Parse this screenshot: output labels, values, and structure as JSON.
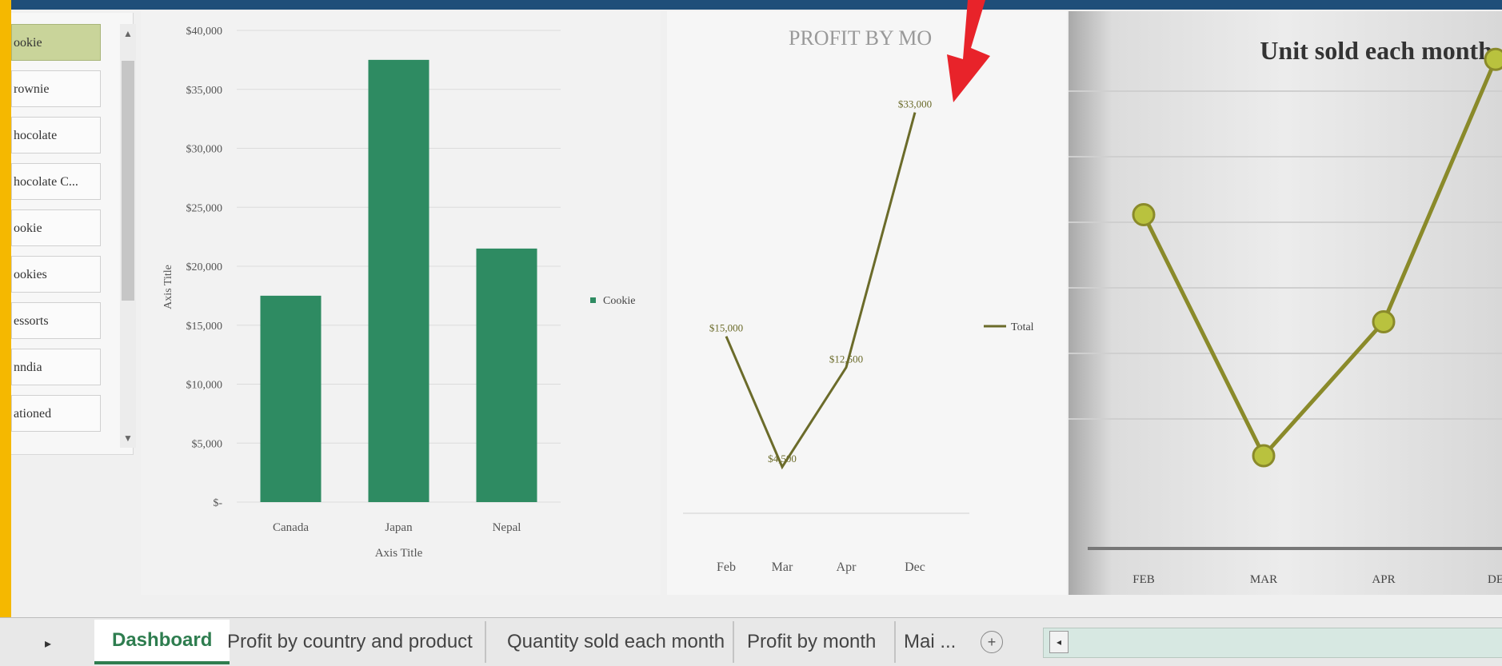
{
  "slicer": {
    "items": [
      {
        "label": "ookie",
        "selected": true
      },
      {
        "label": "rownie",
        "selected": false
      },
      {
        "label": "hocolate",
        "selected": false
      },
      {
        "label": "hocolate C...",
        "selected": false
      },
      {
        "label": "ookie",
        "selected": false
      },
      {
        "label": "ookies",
        "selected": false
      },
      {
        "label": "essorts",
        "selected": false
      },
      {
        "label": "nndia",
        "selected": false
      },
      {
        "label": "ationed",
        "selected": false
      }
    ],
    "scroll_up": "▲",
    "scroll_down": "▼"
  },
  "chart_data": [
    {
      "type": "bar",
      "categories": [
        "Canada",
        "Japan",
        "Nepal"
      ],
      "values": [
        17500,
        37500,
        21500
      ],
      "yticks": [
        "$40,000",
        "$35,000",
        "$30,000",
        "$25,000",
        "$20,000",
        "$15,000",
        "$10,000",
        "$5,000",
        "$-"
      ],
      "ylim": [
        0,
        40000
      ],
      "ylabel": "Axis Title",
      "xlabel": "Axis Title",
      "legend": "Cookie",
      "legend_position": "right",
      "color": "#2e8b62",
      "grid": true
    },
    {
      "type": "line",
      "title": "PROFIT BY MO",
      "x": [
        "Feb",
        "Mar",
        "Apr",
        "Dec"
      ],
      "values": [
        15000,
        4500,
        12500,
        33000
      ],
      "data_labels": [
        "$15,000",
        "$4,500",
        "$12,500",
        "$33,000"
      ],
      "legend": "Total",
      "legend_position": "right",
      "color": "#6b6b2a"
    },
    {
      "type": "line",
      "title": "Unit sold each month",
      "x": [
        "FEB",
        "MAR",
        "APR",
        "DE"
      ],
      "values": [
        3250,
        1000,
        2250,
        4700
      ],
      "ylim": [
        0,
        5000
      ],
      "color": "#8a8a2a",
      "marker_color": "#b9c23e",
      "grid": true
    }
  ],
  "tabs": {
    "nav": "▸",
    "items": [
      {
        "label": "Dashboard",
        "active": true
      },
      {
        "label": "Profit by country and product",
        "active": false
      },
      {
        "label": "Quantity sold each month",
        "active": false
      },
      {
        "label": "Profit by month",
        "active": false
      },
      {
        "label": "Mai ...",
        "active": false
      }
    ],
    "add": "+",
    "scroll_left": "◂"
  },
  "colors": {
    "left_border": "#f5b800",
    "annotation_arrow": "#e8232a",
    "topbar": "#1f4e79"
  }
}
